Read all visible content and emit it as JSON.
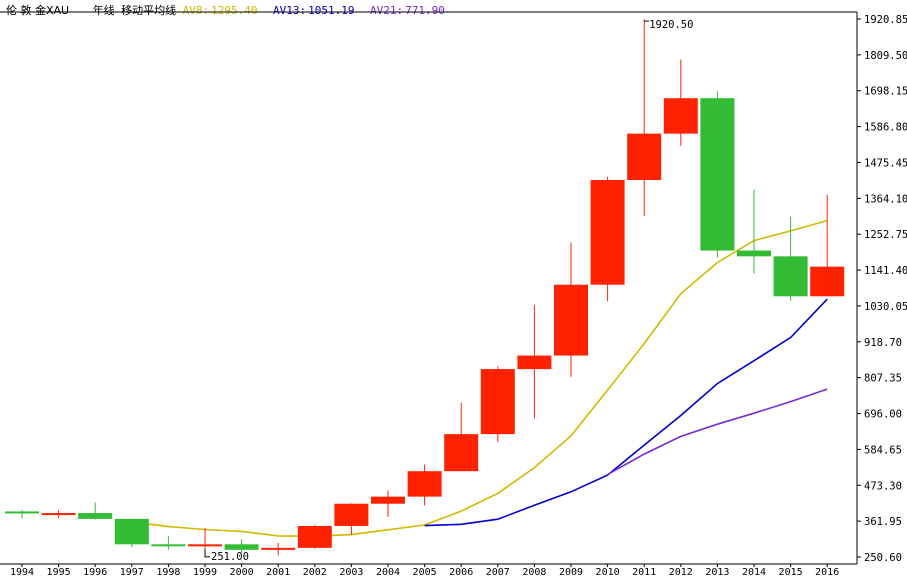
{
  "header": {
    "title": "伦 敦 金XAU",
    "period": "年线",
    "indicator": "移动平均线",
    "ma": [
      {
        "label": "AV8:",
        "value": "1295.40",
        "color": "#d4b800"
      },
      {
        "label": "AV13:",
        "value": "1051.19",
        "color": "#0000cc"
      },
      {
        "label": "AV21:",
        "value": "771.90",
        "color": "#7b2bd6"
      }
    ]
  },
  "colors": {
    "up": "#ff2200",
    "down": "#33bb33",
    "ma8": "#d4b800",
    "ma13": "#0000cc",
    "ma21": "#7b2bd6",
    "axis": "#000000"
  },
  "chart_data": {
    "type": "candlestick",
    "ylim": [
      250.6,
      1920.85
    ],
    "y_ticks": [
      "1920.85",
      "1809.50",
      "1698.15",
      "1586.80",
      "1475.45",
      "1364.10",
      "1252.75",
      "1141.40",
      "1030.05",
      "918.70",
      "807.35",
      "696.00",
      "584.65",
      "473.30",
      "361.95",
      "250.60"
    ],
    "x_ticks": [
      "1994",
      "1995",
      "1996",
      "1997",
      "1998",
      "1999",
      "2000",
      "2001",
      "2002",
      "2003",
      "2004",
      "2005",
      "2006",
      "2007",
      "2008",
      "2009",
      "2010",
      "2011",
      "2012",
      "2013",
      "2014",
      "2015",
      "2016"
    ],
    "annotations": [
      {
        "text": "1920.50",
        "year": "2011",
        "value": 1920.5
      },
      {
        "text": "251.00",
        "year": "1999",
        "value": 251.0
      }
    ],
    "candles": [
      {
        "year": "1994",
        "open": 392,
        "high": 397,
        "low": 371,
        "close": 386
      },
      {
        "year": "1995",
        "open": 386,
        "high": 397,
        "low": 372,
        "close": 387
      },
      {
        "year": "1996",
        "open": 387,
        "high": 420,
        "low": 367,
        "close": 369
      },
      {
        "year": "1997",
        "open": 369,
        "high": 368,
        "low": 281,
        "close": 290
      },
      {
        "year": "1998",
        "open": 290,
        "high": 315,
        "low": 273,
        "close": 288
      },
      {
        "year": "1999",
        "open": 288,
        "high": 340,
        "low": 251,
        "close": 290
      },
      {
        "year": "2000",
        "open": 290,
        "high": 306,
        "low": 263,
        "close": 273
      },
      {
        "year": "2001",
        "open": 273,
        "high": 294,
        "low": 255,
        "close": 279
      },
      {
        "year": "2002",
        "open": 279,
        "high": 350,
        "low": 276,
        "close": 347
      },
      {
        "year": "2003",
        "open": 347,
        "high": 417,
        "low": 320,
        "close": 416
      },
      {
        "year": "2004",
        "open": 416,
        "high": 457,
        "low": 375,
        "close": 438
      },
      {
        "year": "2005",
        "open": 438,
        "high": 538,
        "low": 411,
        "close": 517
      },
      {
        "year": "2006",
        "open": 517,
        "high": 730,
        "low": 520,
        "close": 632
      },
      {
        "year": "2007",
        "open": 632,
        "high": 842,
        "low": 608,
        "close": 834
      },
      {
        "year": "2008",
        "open": 834,
        "high": 1033,
        "low": 681,
        "close": 876
      },
      {
        "year": "2009",
        "open": 876,
        "high": 1227,
        "low": 810,
        "close": 1096
      },
      {
        "year": "2010",
        "open": 1096,
        "high": 1431,
        "low": 1045,
        "close": 1421
      },
      {
        "year": "2011",
        "open": 1421,
        "high": 1920.5,
        "low": 1309,
        "close": 1565
      },
      {
        "year": "2012",
        "open": 1565,
        "high": 1795,
        "low": 1527,
        "close": 1675
      },
      {
        "year": "2013",
        "open": 1675,
        "high": 1696,
        "low": 1180,
        "close": 1202
      },
      {
        "year": "2014",
        "open": 1202,
        "high": 1392,
        "low": 1131,
        "close": 1184
      },
      {
        "year": "2015",
        "open": 1184,
        "high": 1307,
        "low": 1046,
        "close": 1060
      },
      {
        "year": "2016",
        "open": 1060,
        "high": 1375,
        "low": 1061,
        "close": 1152
      }
    ],
    "series": [
      {
        "name": "AV8",
        "values": [
          null,
          null,
          null,
          360,
          345,
          336,
          330,
          316,
          315,
          320,
          335,
          350,
          393,
          448,
          528,
          627,
          769,
          913,
          1068,
          1165,
          1233,
          1263,
          1295
        ]
      },
      {
        "name": "AV13",
        "values": [
          null,
          null,
          null,
          null,
          null,
          null,
          null,
          null,
          null,
          null,
          null,
          348,
          352,
          368,
          411,
          453,
          505,
          598,
          690,
          789,
          860,
          932,
          1051
        ]
      },
      {
        "name": "AV21",
        "values": [
          null,
          null,
          null,
          null,
          null,
          null,
          null,
          null,
          null,
          null,
          null,
          null,
          null,
          null,
          null,
          null,
          507,
          570,
          625,
          663,
          697,
          733,
          772
        ]
      }
    ]
  }
}
